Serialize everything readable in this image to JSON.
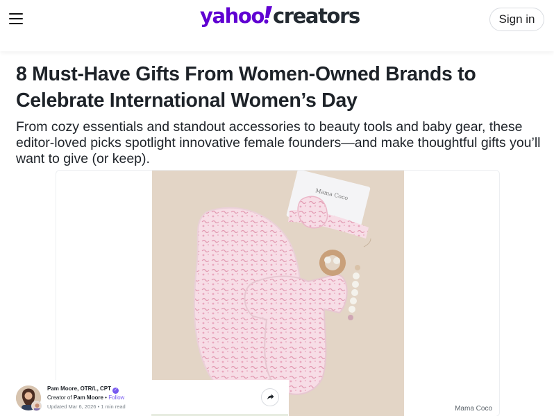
{
  "header": {
    "logo_yahoo": "yahoo",
    "logo_creators": "creators",
    "sign_in_label": "Sign in"
  },
  "article": {
    "title": "8 Must-Have Gifts From Women-Owned Brands to Celebrate International Women’s Day",
    "subtitle": "From cozy essentials and standout accessories to beauty tools and baby gear, these editor-loved picks spotlight innovative female founders—and make thoughtful gifts you’ll want to give (or keep).",
    "image_caption": "Mama Coco"
  },
  "author": {
    "name": "Pam Moore, OTR/L, CPT",
    "creator_prefix": "Creator of",
    "creator_name": "Pam Moore",
    "separator": "•",
    "follow_label": "Follow",
    "updated": "Updated Mar 6, 2026",
    "read_time": "1 min read"
  },
  "colors": {
    "yahoo_purple": "#6001d2",
    "accent_purple": "#7759f0",
    "photo_background": "#e3d5c6"
  },
  "icons": {
    "menu": "hamburger-menu-icon",
    "verified": "verified-check-icon",
    "share": "share-arrow-icon"
  }
}
